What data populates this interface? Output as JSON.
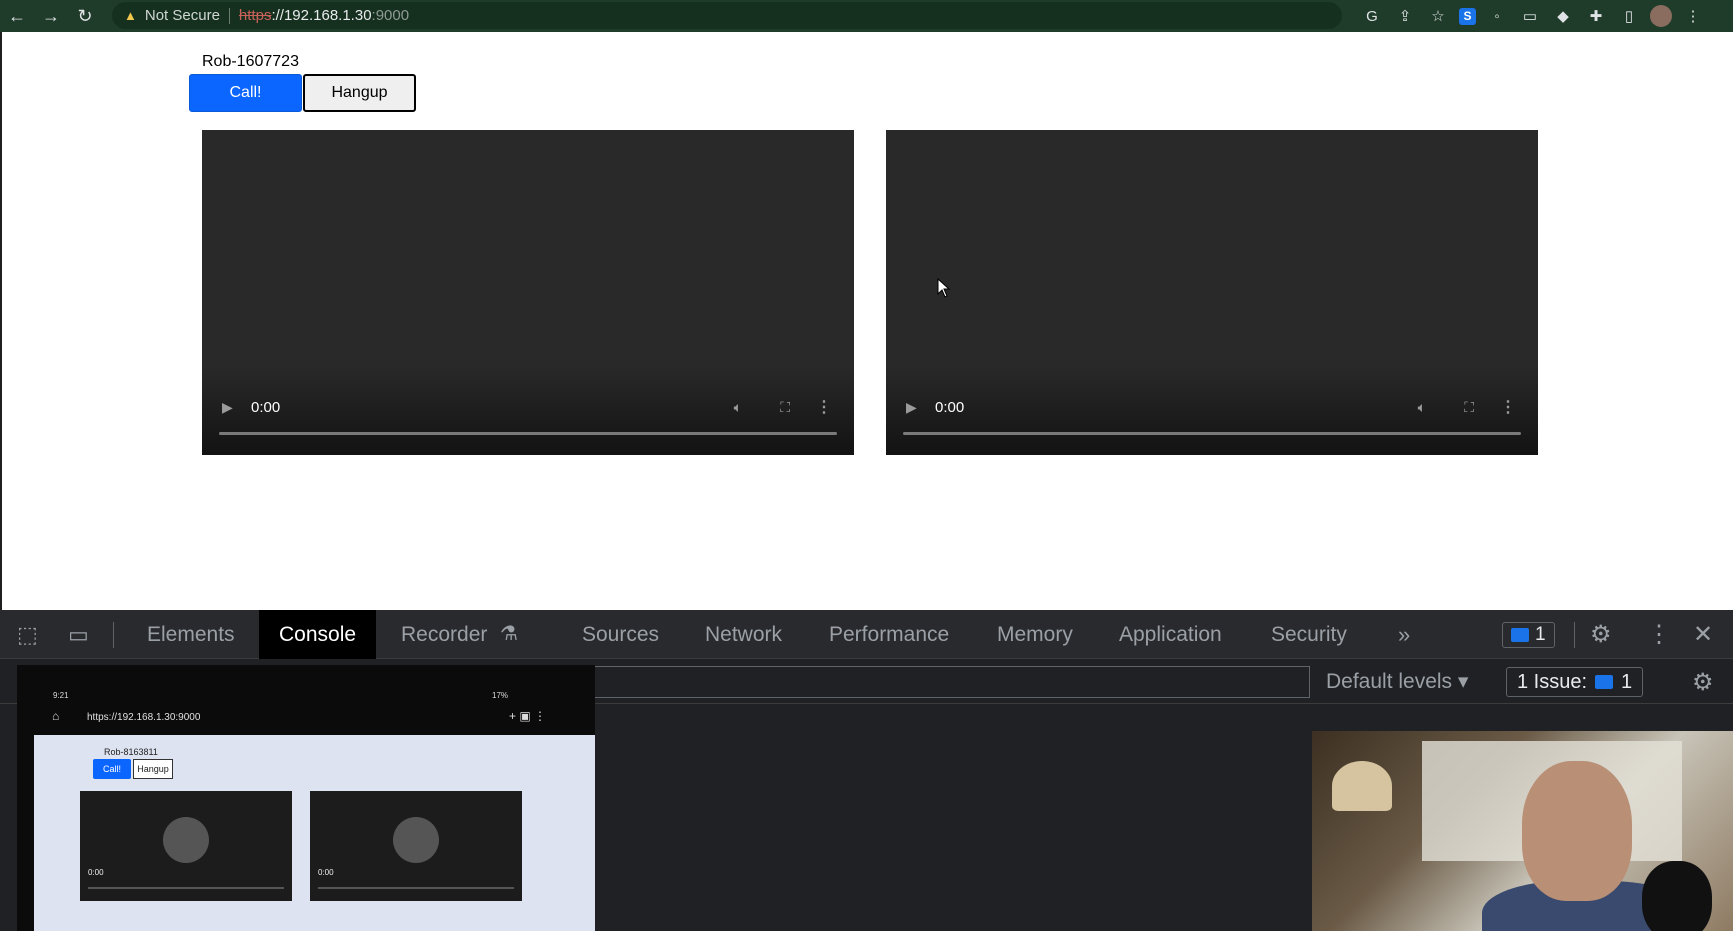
{
  "browser": {
    "security_label": "Not Secure",
    "url_scheme": "https",
    "url_main": "://192.168.1.30",
    "url_port": ":9000",
    "extension_s_label": "S"
  },
  "app": {
    "username": "Rob-1607723",
    "call_label": "Call!",
    "hangup_label": "Hangup",
    "videos": [
      {
        "time": "0:00"
      },
      {
        "time": "0:00"
      }
    ]
  },
  "devtools": {
    "tabs": [
      "Elements",
      "Console",
      "Recorder",
      "Sources",
      "Network",
      "Performance",
      "Memory",
      "Application",
      "Security"
    ],
    "active_tab": "Console",
    "message_count": "1",
    "levels_label": "Default levels",
    "issue_label": "1 Issue:",
    "issue_count": "1"
  },
  "phone": {
    "status_time": "9:21",
    "status_right": "17%",
    "url": "https://192.168.1.30:9000",
    "username": "Rob-8163811",
    "call_label": "Call!",
    "hangup_label": "Hangup",
    "videos": [
      {
        "time": "0:00"
      },
      {
        "time": "0:00"
      }
    ]
  },
  "colors": {
    "topbar": "#1f3b2a",
    "call_button": "#0a66ff",
    "video_bg": "#292929",
    "devtools_bg": "#202124"
  }
}
